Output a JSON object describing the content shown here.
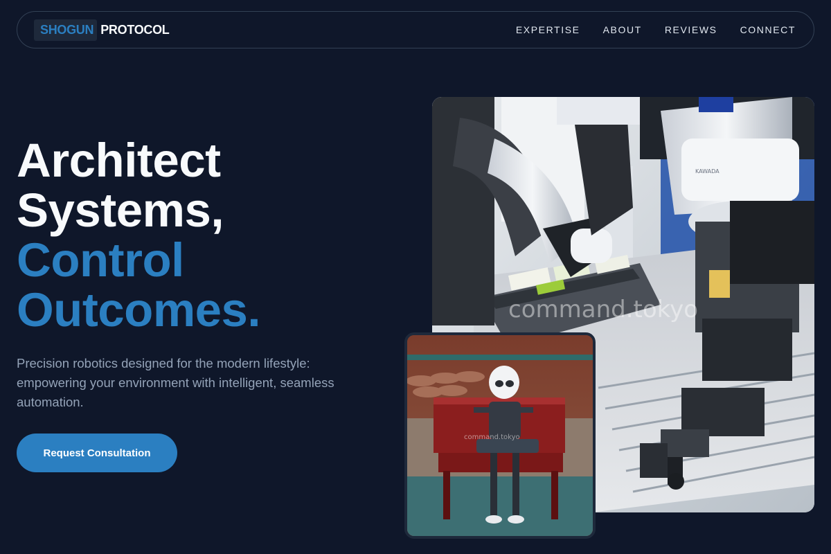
{
  "nav": {
    "logo_part1": "SHOGUN",
    "logo_part2": "PROTOCOL",
    "links": [
      "EXPERTISE",
      "ABOUT",
      "REVIEWS",
      "CONNECT"
    ]
  },
  "hero": {
    "title_line1": "Architect",
    "title_line2": "Systems,",
    "title_line3": "Control",
    "title_line4": "Outcomes.",
    "subtitle": "Precision robotics designed for the modern lifestyle: empowering your environment with intelligent, seamless automation.",
    "cta_label": "Request Consultation"
  },
  "images": {
    "main_watermark": "command.tokyo",
    "main_brand": "KAWADA",
    "card_watermark": "command.tokyo"
  },
  "colors": {
    "background": "#0f172a",
    "accent": "#2b7fc1",
    "nav_border": "#334155",
    "muted_text": "#94a3b8"
  }
}
